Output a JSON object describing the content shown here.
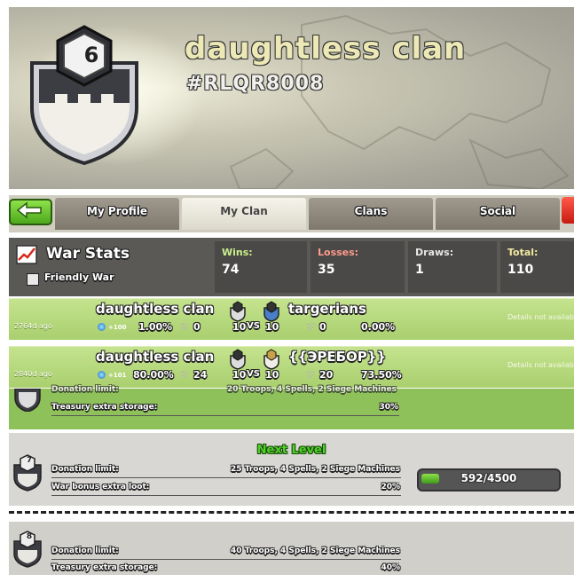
{
  "header": {
    "clan_level": "6",
    "clan_name": "daughtless clan",
    "clan_tag": "#RLQR8008"
  },
  "nav": {
    "tabs": [
      {
        "label": "My Profile",
        "active": false
      },
      {
        "label": "My Clan",
        "active": true
      },
      {
        "label": "Clans",
        "active": false
      },
      {
        "label": "Social",
        "active": false
      }
    ]
  },
  "war_stats": {
    "title": "War Stats",
    "friendly_war_label": "Friendly War",
    "friendly_war_checked": false,
    "wins_label": "Wins:",
    "wins": "74",
    "losses_label": "Losses:",
    "losses": "35",
    "draws_label": "Draws:",
    "draws": "1",
    "total_label": "Total:",
    "total": "110"
  },
  "war_log": [
    {
      "ago": "2764d ago",
      "our_clan": "daughtless clan",
      "opponent": "targerians",
      "our_level": "6",
      "opp_level": "4",
      "xp": "+100",
      "our_pct": "1.00%",
      "our_stars": "0",
      "lineup_left": "10",
      "vs": "VS",
      "lineup_right": "10",
      "opp_stars": "0",
      "opp_pct": "0.00%",
      "details": "Details not availab"
    },
    {
      "ago": "2840d ago",
      "our_clan": "daughtless clan",
      "opponent": "{{ЭРЕБОР}}",
      "our_level": "6",
      "opp_level": "",
      "xp": "+101",
      "our_pct": "80.00%",
      "our_stars": "24",
      "lineup_left": "10",
      "vs": "VS",
      "lineup_right": "10",
      "opp_stars": "20",
      "opp_pct": "73.50%",
      "details": "Details not availab"
    }
  ],
  "perks": {
    "current": {
      "partial_label": "Donation limit:",
      "partial_value": "20 Troops, 4 Spells, 2 Siege Machines",
      "storage_label": "Treasury extra storage:",
      "storage_value": "30%"
    },
    "next_level_title": "Next Level",
    "next": {
      "level": "7",
      "donation_label": "Donation limit:",
      "donation_value": "25 Troops, 4 Spells, 2 Siege Machines",
      "loot_label": "War bonus extra loot:",
      "loot_value": "20%"
    },
    "progress_text": "592/4500",
    "progress_value": 592,
    "progress_max": 4500,
    "following": {
      "level": "8",
      "donation_label": "Donation limit:",
      "donation_value": "40 Troops, 4 Spells, 2 Siege Machines",
      "storage_label": "Treasury extra storage:",
      "storage_value": "40%"
    }
  },
  "colors": {
    "header_name": "#ece9b6",
    "win_label": "#c9f08a",
    "loss_label": "#ff9a8a",
    "row_green": "#b5d97d"
  }
}
